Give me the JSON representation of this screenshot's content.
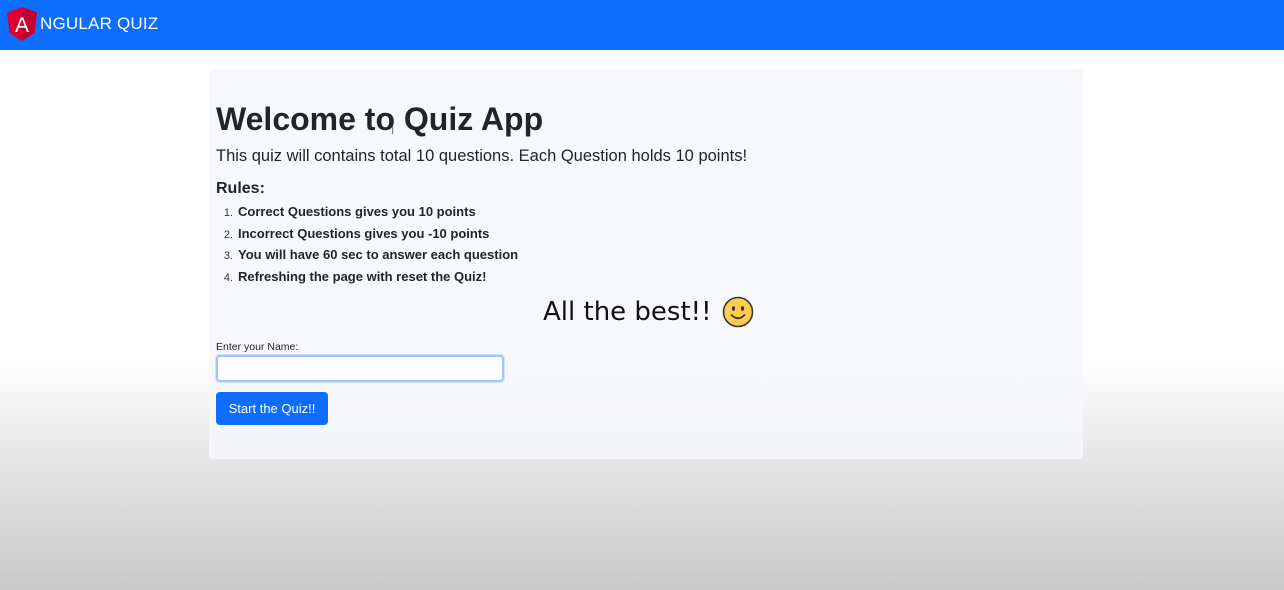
{
  "navbar": {
    "brand_text": "NGULAR QUIZ",
    "logo_letter": "A",
    "color": "#0d6efd"
  },
  "main": {
    "title": "Welcome to Quiz App",
    "subtitle": "This quiz will contains total 10 questions. Each Question holds 10 points!",
    "rules_heading": "Rules:",
    "rules": [
      {
        "num": "1.",
        "text": "Correct Questions gives you 10 points"
      },
      {
        "num": "2.",
        "text": "Incorrect Questions gives you -10 points"
      },
      {
        "num": "3.",
        "text": "You will have 60 sec to answer each question"
      },
      {
        "num": "4.",
        "text": "Refreshing the page with reset the Quiz!"
      }
    ],
    "best_wishes": "All the best!!",
    "name_label": "Enter your Name:",
    "name_value": "",
    "start_label": "Start the Quiz!!",
    "icons": {
      "logo": "angular-logo-icon",
      "smiley": "smiley-icon"
    }
  }
}
